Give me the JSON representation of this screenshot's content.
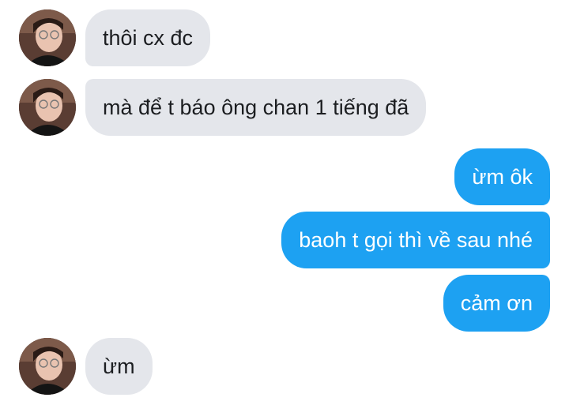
{
  "messages": [
    {
      "direction": "incoming",
      "text": "thôi cx đc",
      "avatar": "profile-avatar"
    },
    {
      "direction": "incoming",
      "text": "mà để t báo ông chan 1 tiếng đã",
      "avatar": "profile-avatar"
    },
    {
      "direction": "outgoing",
      "text": "ừm ôk"
    },
    {
      "direction": "outgoing",
      "text": "baoh t gọi thì về sau nhé"
    },
    {
      "direction": "outgoing",
      "text": "cảm ơn"
    },
    {
      "direction": "incoming",
      "text": "ừm",
      "avatar": "profile-avatar"
    }
  ],
  "colors": {
    "incoming_bubble": "#e4e6eb",
    "incoming_text": "#1c1e21",
    "outgoing_bubble": "#1da1f2",
    "outgoing_text": "#ffffff"
  }
}
